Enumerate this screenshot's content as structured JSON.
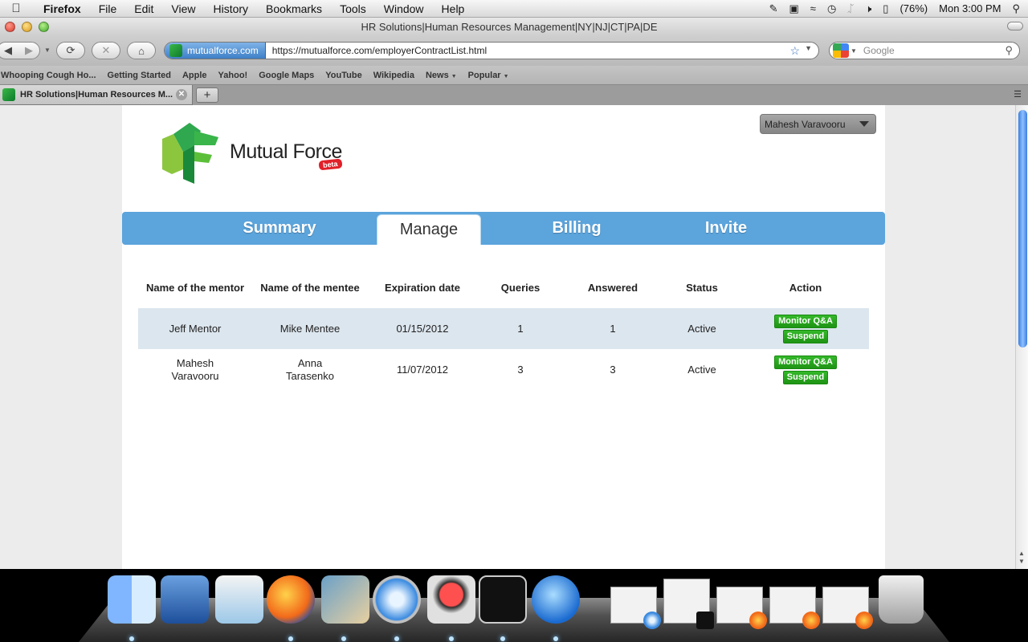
{
  "menubar": {
    "app": "Firefox",
    "items": [
      "File",
      "Edit",
      "View",
      "History",
      "Bookmarks",
      "Tools",
      "Window",
      "Help"
    ],
    "battery": "(76%)",
    "clock": "Mon 3:00 PM"
  },
  "window": {
    "title": "HR Solutions|Human Resources Management|NY|NJ|CT|PA|DE"
  },
  "navbar": {
    "site_identity": "mutualforce.com",
    "url": "https://mutualforce.com/employerContractList.html",
    "search_placeholder": "Google"
  },
  "bookmarks": [
    {
      "label": "Whooping Cough Ho...",
      "dropdown": false
    },
    {
      "label": "Getting Started",
      "dropdown": false
    },
    {
      "label": "Apple",
      "dropdown": false
    },
    {
      "label": "Yahoo!",
      "dropdown": false
    },
    {
      "label": "Google Maps",
      "dropdown": false
    },
    {
      "label": "YouTube",
      "dropdown": false
    },
    {
      "label": "Wikipedia",
      "dropdown": false
    },
    {
      "label": "News",
      "dropdown": true
    },
    {
      "label": "Popular",
      "dropdown": true
    }
  ],
  "tabs": [
    {
      "label": "HR Solutions|Human Resources M...",
      "active": true
    }
  ],
  "page": {
    "brand": "Mutual Force",
    "beta": "beta",
    "user": "Mahesh Varavooru",
    "nav_tabs": [
      {
        "label": "Summary",
        "active": false
      },
      {
        "label": "Manage",
        "active": true
      },
      {
        "label": "Billing",
        "active": false
      },
      {
        "label": "Invite",
        "active": false
      }
    ],
    "table": {
      "headers": [
        "Name of the mentor",
        "Name of the mentee",
        "Expiration date",
        "Queries",
        "Answered",
        "Status",
        "Action"
      ],
      "rows": [
        {
          "mentor": "Jeff Mentor",
          "mentee": "Mike Mentee",
          "expiration": "01/15/2012",
          "queries": "1",
          "answered": "1",
          "status": "Active"
        },
        {
          "mentor": "Mahesh Varavooru",
          "mentee": "Anna Tarasenko",
          "expiration": "11/07/2012",
          "queries": "3",
          "answered": "3",
          "status": "Active"
        }
      ],
      "actions": {
        "monitor": "Monitor Q&A",
        "suspend": "Suspend"
      }
    }
  },
  "colors": {
    "nav_blue": "#5ba4dc",
    "row_shade": "#dce6ee",
    "action_green": "#2aa820",
    "beta_red": "#e0202a"
  },
  "dock": {
    "apps": [
      "finder-icon",
      "network-utility-icon",
      "system-utility-icon",
      "firefox-icon",
      "iphoto-icon",
      "safari-icon",
      "recorder-icon",
      "terminal-icon",
      "mail-icon"
    ],
    "minimized_windows": 5,
    "trash": "trash-icon"
  }
}
